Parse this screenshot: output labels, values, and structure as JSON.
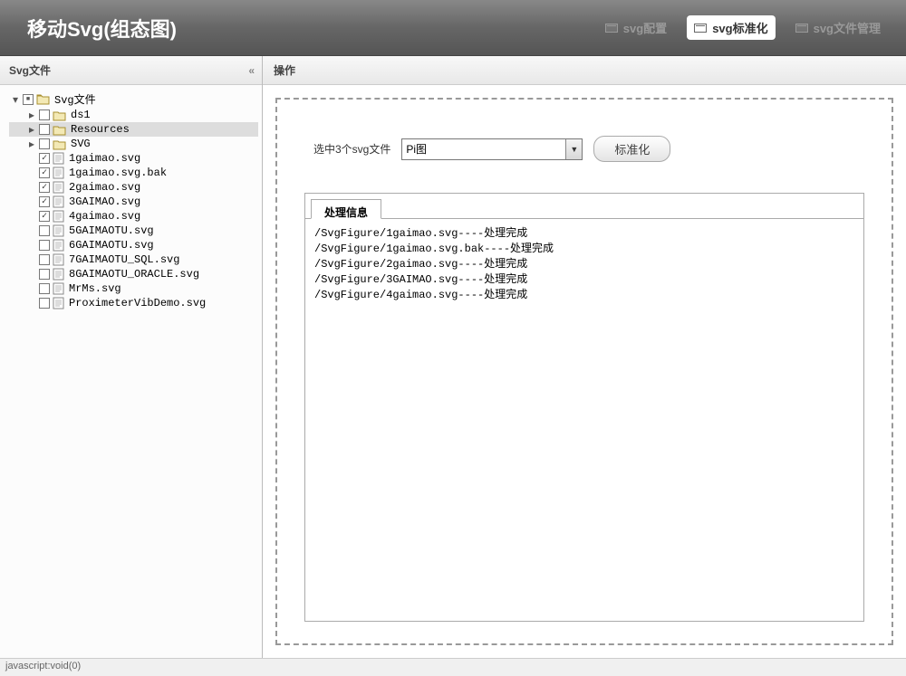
{
  "header": {
    "title": "移动Svg(组态图)",
    "tabs": [
      {
        "label": "svg配置",
        "active": false
      },
      {
        "label": "svg标准化",
        "active": true
      },
      {
        "label": "svg文件管理",
        "active": false
      }
    ]
  },
  "sidebar": {
    "title": "Svg文件",
    "collapse_symbol": "«"
  },
  "tree": [
    {
      "depth": 0,
      "expander": "▾",
      "check": "partial",
      "icon": "folder-open",
      "label": "Svg文件",
      "selected": false
    },
    {
      "depth": 1,
      "expander": "▸",
      "check": "none",
      "icon": "folder",
      "label": "ds1",
      "selected": false
    },
    {
      "depth": 1,
      "expander": "▸",
      "check": "none",
      "icon": "folder",
      "label": "Resources",
      "selected": true
    },
    {
      "depth": 1,
      "expander": "▸",
      "check": "none",
      "icon": "folder",
      "label": "SVG",
      "selected": false
    },
    {
      "depth": 1,
      "expander": "",
      "check": "checked",
      "icon": "file",
      "label": "1gaimao.svg",
      "selected": false
    },
    {
      "depth": 1,
      "expander": "",
      "check": "checked",
      "icon": "file",
      "label": "1gaimao.svg.bak",
      "selected": false
    },
    {
      "depth": 1,
      "expander": "",
      "check": "checked",
      "icon": "file",
      "label": "2gaimao.svg",
      "selected": false
    },
    {
      "depth": 1,
      "expander": "",
      "check": "checked",
      "icon": "file",
      "label": "3GAIMAO.svg",
      "selected": false
    },
    {
      "depth": 1,
      "expander": "",
      "check": "checked",
      "icon": "file",
      "label": "4gaimao.svg",
      "selected": false
    },
    {
      "depth": 1,
      "expander": "",
      "check": "none",
      "icon": "file",
      "label": "5GAIMAOTU.svg",
      "selected": false
    },
    {
      "depth": 1,
      "expander": "",
      "check": "none",
      "icon": "file",
      "label": "6GAIMAOTU.svg",
      "selected": false
    },
    {
      "depth": 1,
      "expander": "",
      "check": "none",
      "icon": "file",
      "label": "7GAIMAOTU_SQL.svg",
      "selected": false
    },
    {
      "depth": 1,
      "expander": "",
      "check": "none",
      "icon": "file",
      "label": "8GAIMAOTU_ORACLE.svg",
      "selected": false
    },
    {
      "depth": 1,
      "expander": "",
      "check": "none",
      "icon": "file",
      "label": "MrMs.svg",
      "selected": false
    },
    {
      "depth": 1,
      "expander": "",
      "check": "none",
      "icon": "file",
      "label": "ProximeterVibDemo.svg",
      "selected": false
    }
  ],
  "content": {
    "title": "操作",
    "select_label": "选中3个svg文件",
    "select_value": "Pi图",
    "action_button": "标准化",
    "info_tab_label": "处理信息",
    "log_lines": [
      "/SvgFigure/1gaimao.svg----处理完成",
      "/SvgFigure/1gaimao.svg.bak----处理完成",
      "/SvgFigure/2gaimao.svg----处理完成",
      "/SvgFigure/3GAIMAO.svg----处理完成",
      "/SvgFigure/4gaimao.svg----处理完成"
    ]
  },
  "statusbar": {
    "text": "javascript:void(0)"
  }
}
